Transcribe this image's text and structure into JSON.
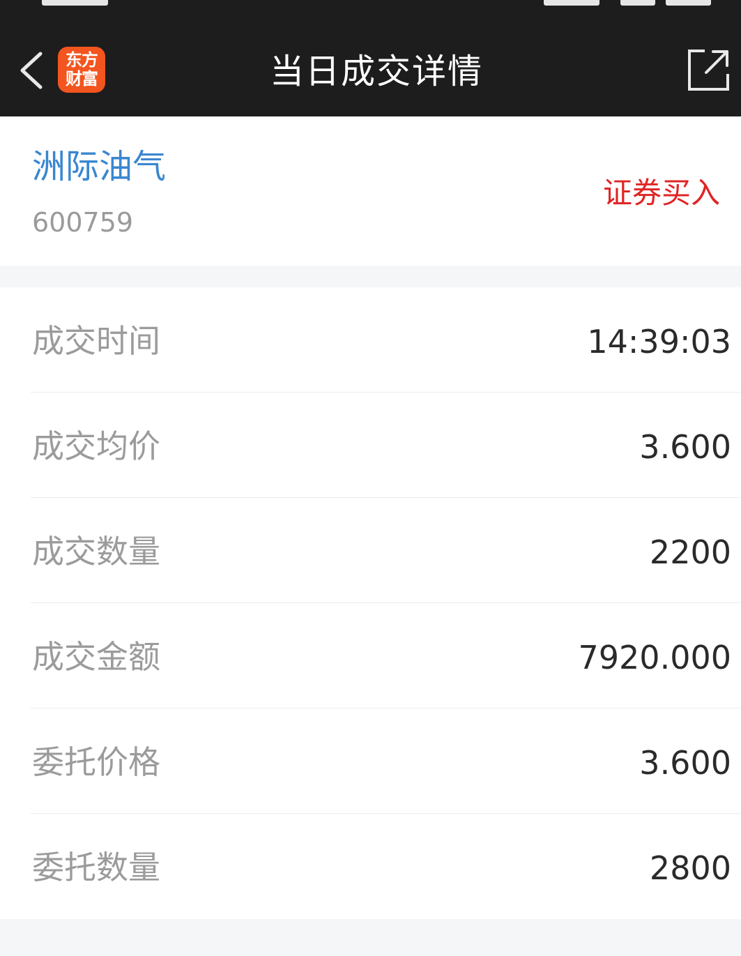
{
  "header": {
    "title": "当日成交详情",
    "logo_lines": [
      "东方",
      "财富"
    ],
    "back_icon": "chevron-left-icon",
    "share_icon": "external-link-icon"
  },
  "stock": {
    "name": "洲际油气",
    "code": "600759",
    "trade_type": "证券买入"
  },
  "details": [
    {
      "label": "成交时间",
      "value": "14:39:03"
    },
    {
      "label": "成交均价",
      "value": "3.600"
    },
    {
      "label": "成交数量",
      "value": "2200"
    },
    {
      "label": "成交金额",
      "value": "7920.000"
    },
    {
      "label": "委托价格",
      "value": "3.600"
    },
    {
      "label": "委托数量",
      "value": "2800"
    }
  ],
  "colors": {
    "topbar": "#1d1d1d",
    "logo": "#f2551f",
    "stock_name": "#3a86d0",
    "trade_type": "#e02525"
  }
}
